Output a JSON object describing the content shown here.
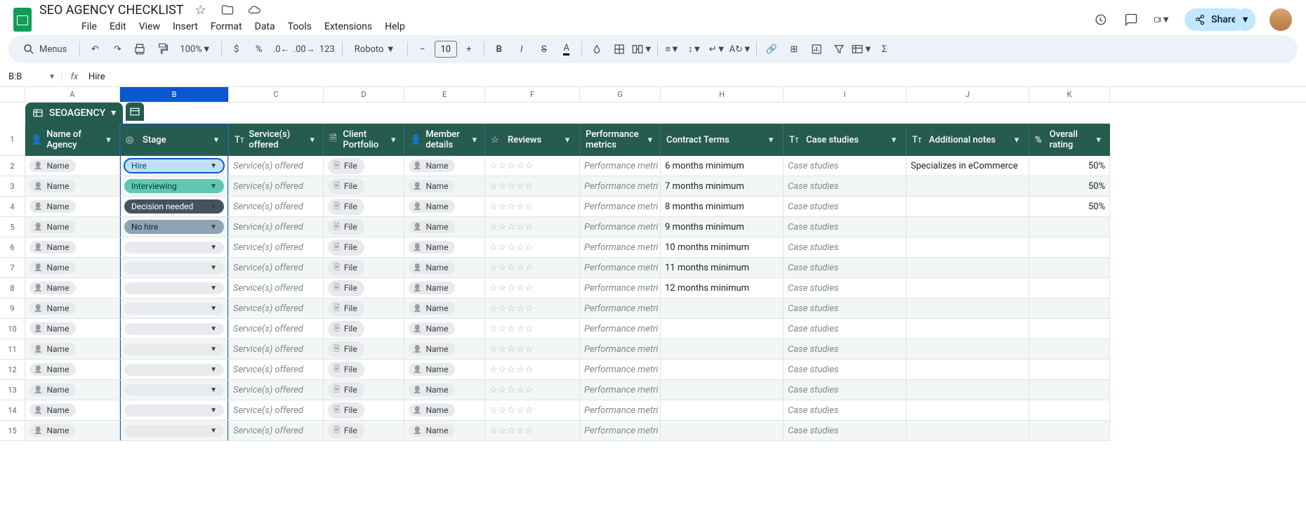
{
  "doc": {
    "title": "SEO AGENCY CHECKLIST"
  },
  "menus": {
    "file": "File",
    "edit": "Edit",
    "view": "View",
    "insert": "Insert",
    "format": "Format",
    "data": "Data",
    "tools": "Tools",
    "extensions": "Extensions",
    "help": "Help"
  },
  "toolbar": {
    "search": "Menus",
    "zoom": "100%",
    "currency": "$",
    "percent": "%",
    "num123": "123",
    "font": "Roboto",
    "fontsize": "10"
  },
  "share": {
    "label": "Share"
  },
  "namebox": {
    "ref": "B:B"
  },
  "formula": {
    "value": "Hire"
  },
  "tab": {
    "name": "SEOAGENCY"
  },
  "col_letters": [
    "A",
    "B",
    "C",
    "D",
    "E",
    "F",
    "G",
    "H",
    "I",
    "J",
    "K"
  ],
  "headers": {
    "name": "Name of Agency",
    "stage": "Stage",
    "services": "Service(s) offered",
    "portfolio": "Client Portfolio",
    "member": "Member details",
    "reviews": "Reviews",
    "perf": "Performance metrics",
    "contract": "Contract Terms",
    "cases": "Case studies",
    "notes": "Additional notes",
    "overall": "Overall rating"
  },
  "placeholders": {
    "name": "Name",
    "services": "Service(s) offered",
    "file": "File",
    "member": "Name",
    "perf": "Performance metri",
    "case": "Case studies"
  },
  "pills": {
    "hire": "Hire",
    "interview": "Interviewing",
    "decide": "Decision needed",
    "nohire": "No hire"
  },
  "rows": [
    {
      "stage": "hire",
      "contract": "6 months minimum",
      "notes": "Specializes in eCommerce",
      "overall": "50%"
    },
    {
      "stage": "interview",
      "contract": "7 months minimum",
      "notes": "",
      "overall": "50%"
    },
    {
      "stage": "decide",
      "contract": "8 months minimum",
      "notes": "",
      "overall": "50%"
    },
    {
      "stage": "nohire",
      "contract": "9 months minimum",
      "notes": "",
      "overall": ""
    },
    {
      "stage": "",
      "contract": "10 months minimum",
      "notes": "",
      "overall": ""
    },
    {
      "stage": "",
      "contract": "11 months minimum",
      "notes": "",
      "overall": ""
    },
    {
      "stage": "",
      "contract": "12 months minimum",
      "notes": "",
      "overall": ""
    },
    {
      "stage": "",
      "contract": "",
      "notes": "",
      "overall": ""
    },
    {
      "stage": "",
      "contract": "",
      "notes": "",
      "overall": ""
    },
    {
      "stage": "",
      "contract": "",
      "notes": "",
      "overall": ""
    },
    {
      "stage": "",
      "contract": "",
      "notes": "",
      "overall": ""
    },
    {
      "stage": "",
      "contract": "",
      "notes": "",
      "overall": ""
    },
    {
      "stage": "",
      "contract": "",
      "notes": "",
      "overall": ""
    },
    {
      "stage": "",
      "contract": "",
      "notes": "",
      "overall": ""
    }
  ],
  "stars": "☆☆☆☆☆"
}
